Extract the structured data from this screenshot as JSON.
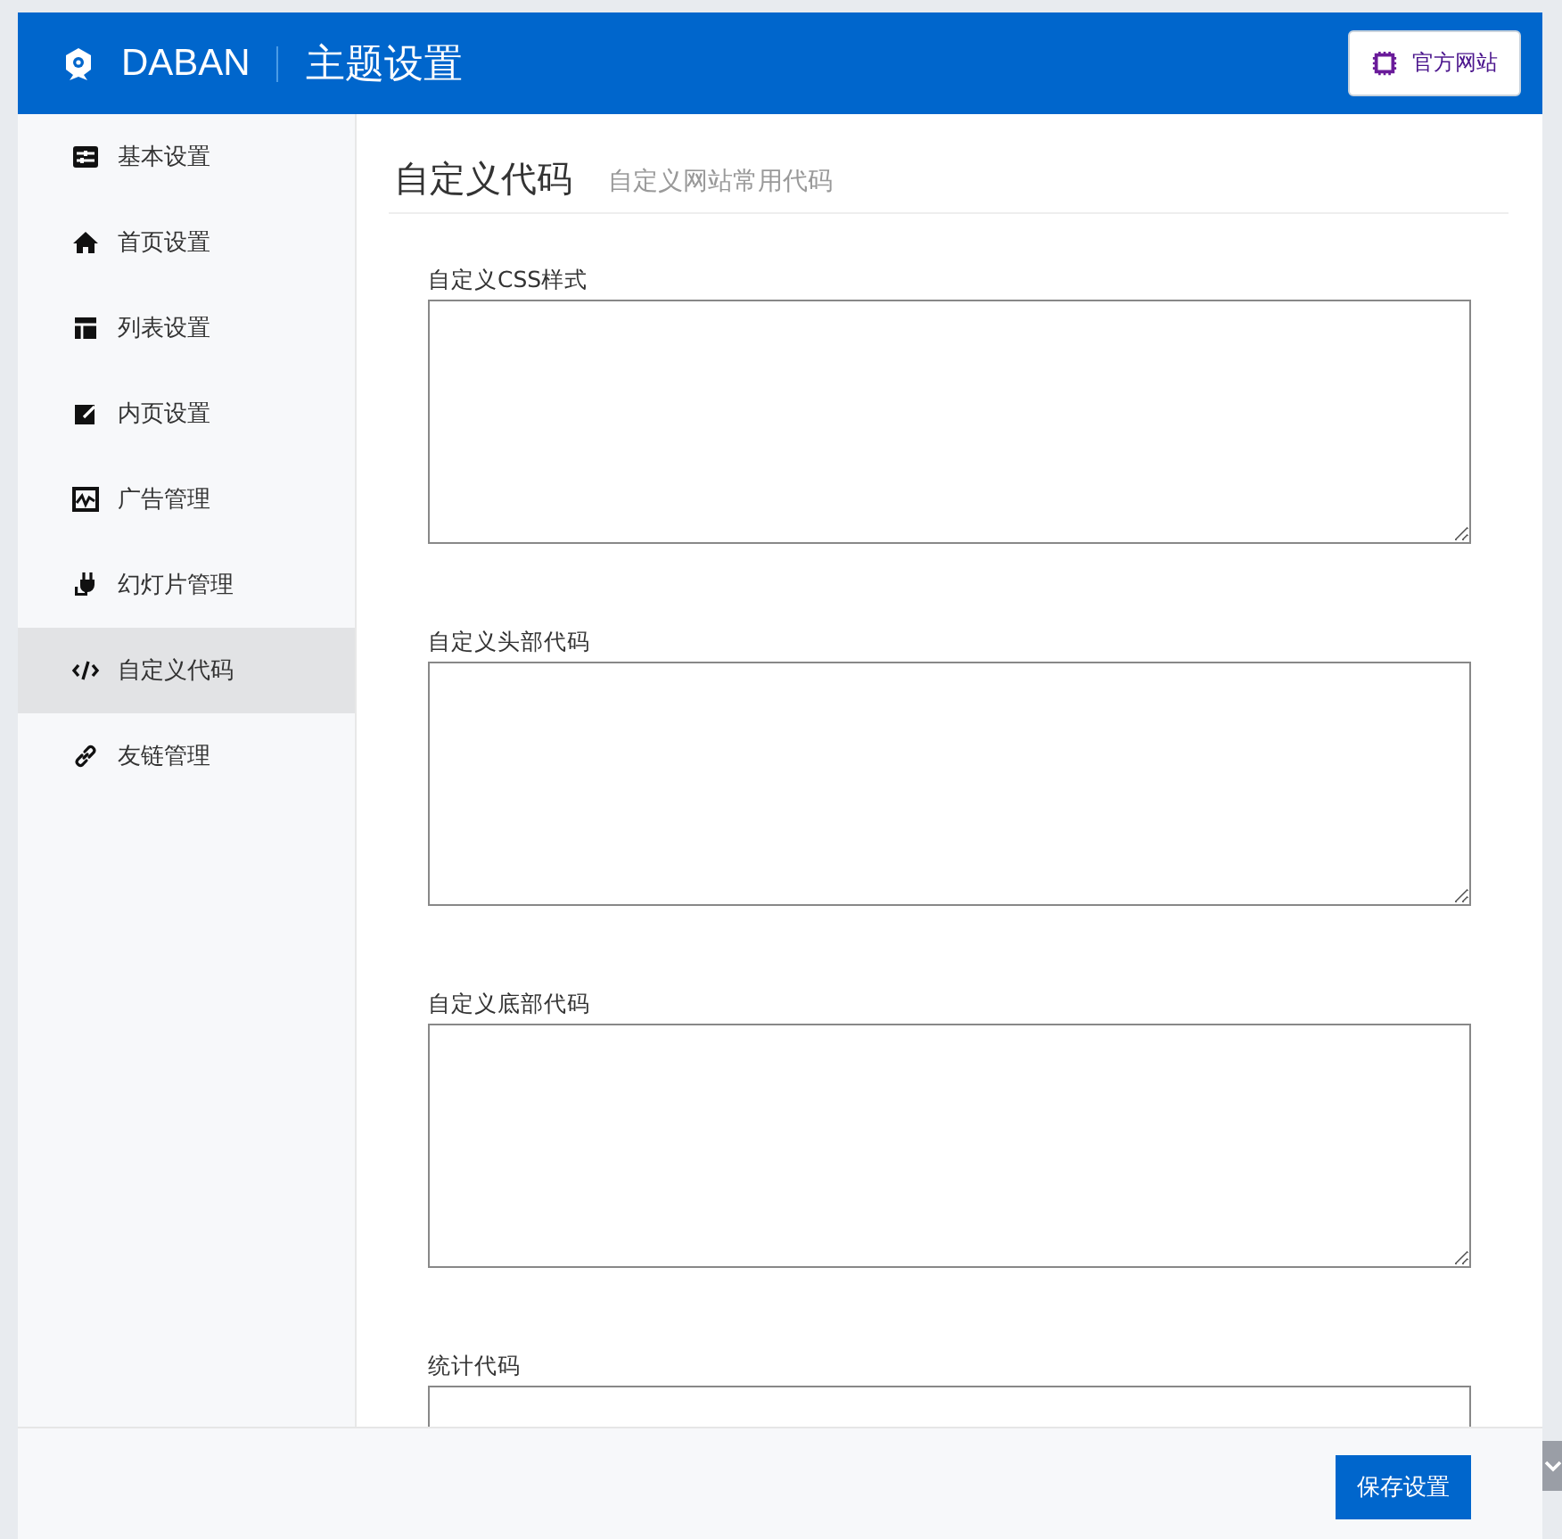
{
  "header": {
    "logo_text": "DABAN",
    "title": "主题设置",
    "site_button": "官方网站"
  },
  "sidebar": {
    "items": [
      {
        "label": "基本设置",
        "selected": false
      },
      {
        "label": "首页设置",
        "selected": false
      },
      {
        "label": "列表设置",
        "selected": false
      },
      {
        "label": "内页设置",
        "selected": false
      },
      {
        "label": "广告管理",
        "selected": false
      },
      {
        "label": "幻灯片管理",
        "selected": false
      },
      {
        "label": "自定义代码",
        "selected": true
      },
      {
        "label": "友链管理",
        "selected": false
      }
    ]
  },
  "section": {
    "title": "自定义代码",
    "subtitle": "自定义网站常用代码"
  },
  "fields": [
    {
      "label": "自定义CSS样式"
    },
    {
      "label": "自定义头部代码"
    },
    {
      "label": "自定义底部代码"
    },
    {
      "label": "统计代码"
    }
  ],
  "footer": {
    "save_button": "保存设置"
  }
}
